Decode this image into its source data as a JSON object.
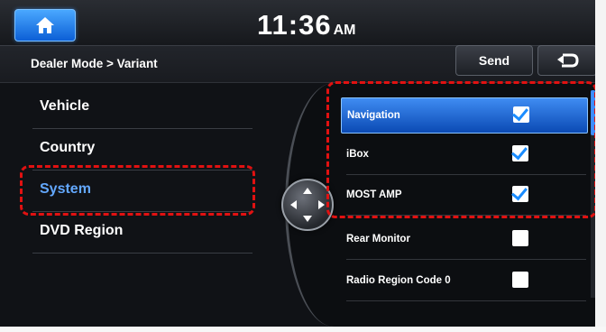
{
  "header": {
    "time": "11:36",
    "ampm": "AM"
  },
  "subheader": {
    "breadcrumb": "Dealer Mode > Variant",
    "send_label": "Send"
  },
  "left_menu": [
    {
      "label": "Vehicle",
      "selected": false
    },
    {
      "label": "Country",
      "selected": false
    },
    {
      "label": "System",
      "selected": true
    },
    {
      "label": "DVD Region",
      "selected": false
    }
  ],
  "options": [
    {
      "label": "Navigation",
      "checked": true,
      "selected": true
    },
    {
      "label": "iBox",
      "checked": true,
      "selected": false
    },
    {
      "label": "MOST AMP",
      "checked": true,
      "selected": false
    },
    {
      "label": "Rear Monitor",
      "checked": false,
      "selected": false
    },
    {
      "label": "Radio Region Code 0",
      "checked": false,
      "selected": false
    }
  ],
  "colors": {
    "accent": "#3d8dff",
    "highlight": "#e11111"
  },
  "icons": {
    "home": "home-icon",
    "back": "back-arrow-icon",
    "joystick": "directional-pad-icon"
  }
}
